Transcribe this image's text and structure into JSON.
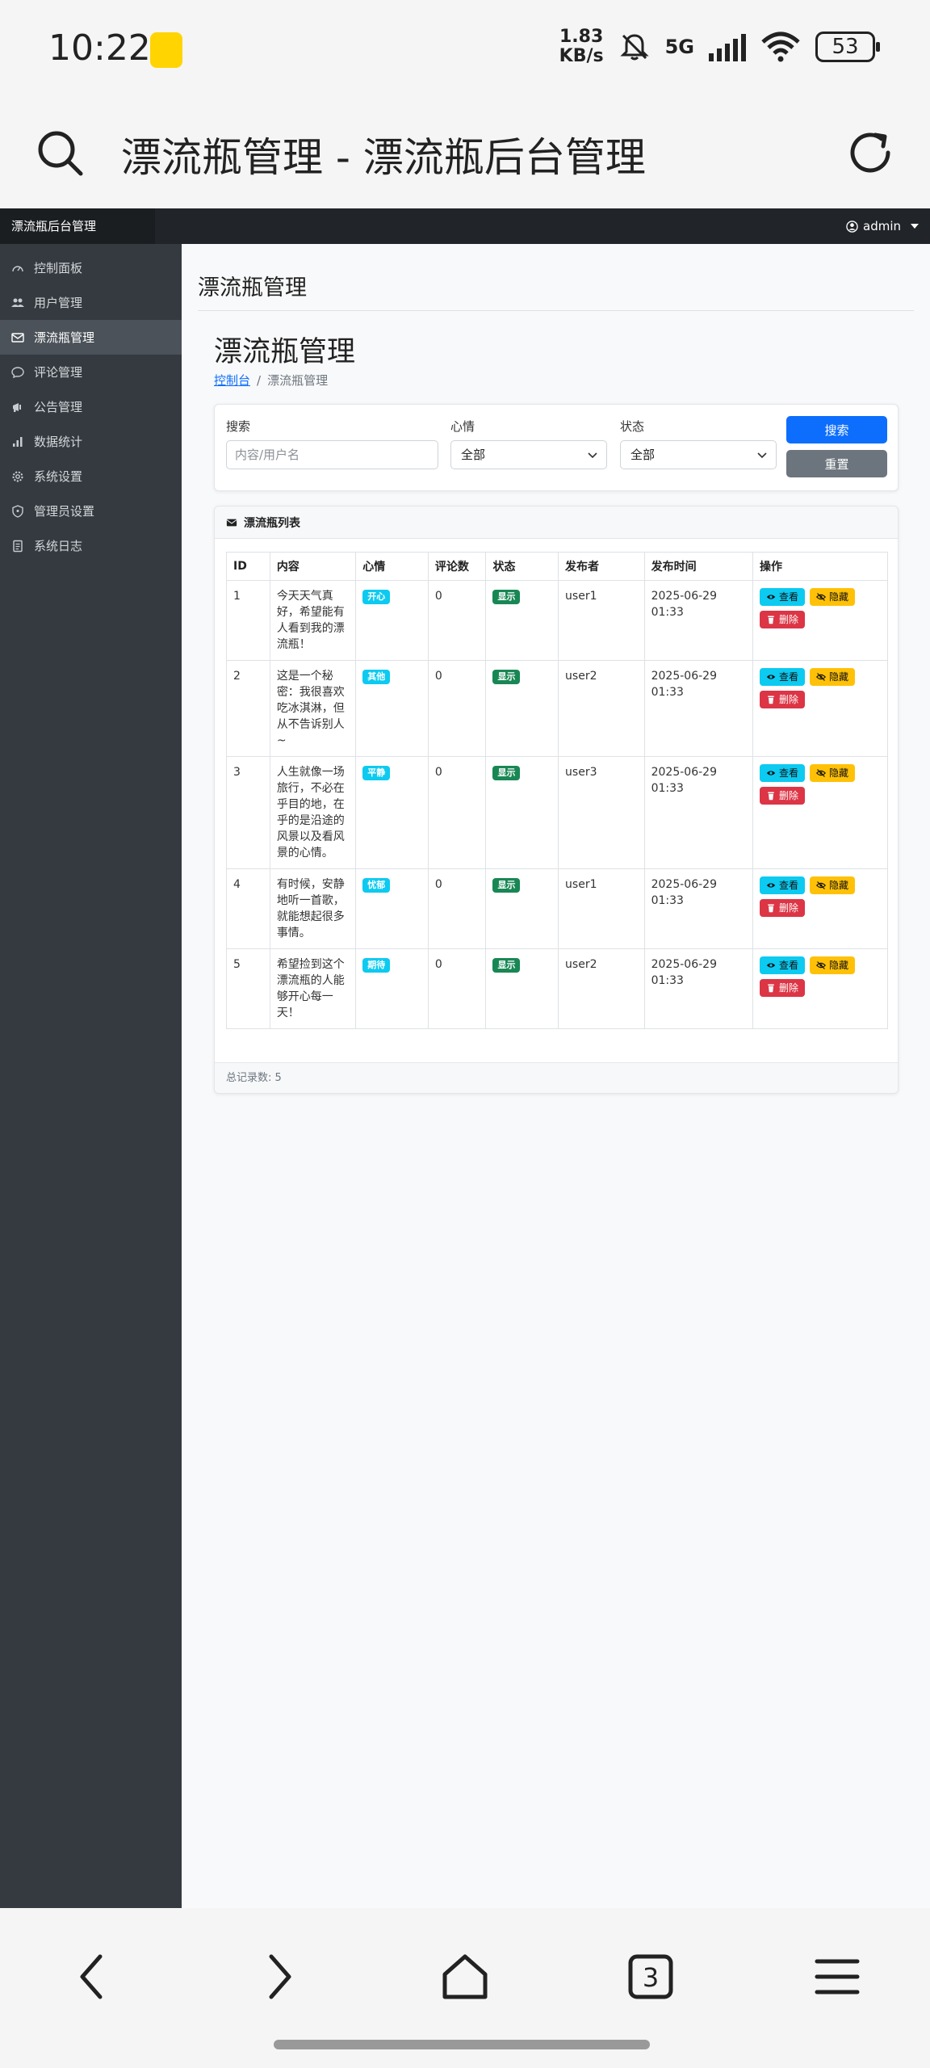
{
  "status_bar": {
    "time": "10:22",
    "net_speed_value": "1.83",
    "net_speed_unit": "KB/s",
    "network": "5G",
    "wifi_sub": "6",
    "battery": "53"
  },
  "browser": {
    "title": "漂流瓶管理 - 漂流瓶后台管理"
  },
  "navbar": {
    "brand": "漂流瓶后台管理",
    "user": "admin"
  },
  "sidebar": {
    "items": [
      {
        "label": "控制面板",
        "icon": "speedometer-icon"
      },
      {
        "label": "用户管理",
        "icon": "users-icon"
      },
      {
        "label": "漂流瓶管理",
        "icon": "envelope-icon",
        "active": true
      },
      {
        "label": "评论管理",
        "icon": "chat-icon"
      },
      {
        "label": "公告管理",
        "icon": "megaphone-icon"
      },
      {
        "label": "数据统计",
        "icon": "bar-chart-icon"
      },
      {
        "label": "系统设置",
        "icon": "gear-icon"
      },
      {
        "label": "管理员设置",
        "icon": "shield-icon"
      },
      {
        "label": "系统日志",
        "icon": "log-icon"
      }
    ]
  },
  "page": {
    "head": "漂流瓶管理",
    "title": "漂流瓶管理",
    "breadcrumb": {
      "home": "控制台",
      "current": "漂流瓶管理"
    }
  },
  "filter": {
    "search_label": "搜索",
    "search_placeholder": "内容/用户名",
    "search_value": "",
    "mood_label": "心情",
    "mood_value": "全部",
    "status_label": "状态",
    "status_value": "全部",
    "search_button": "搜索",
    "reset_button": "重置"
  },
  "list": {
    "title": "漂流瓶列表",
    "columns": [
      "ID",
      "内容",
      "心情",
      "评论数",
      "状态",
      "发布者",
      "发布时间",
      "操作"
    ],
    "actions": {
      "view": "查看",
      "hide": "隐藏",
      "delete": "删除"
    },
    "rows": [
      {
        "id": "1",
        "content": "今天天气真好，希望能有人看到我的漂流瓶！",
        "mood": "开心",
        "comments": "0",
        "status": "显示",
        "user": "user1",
        "date": "2025-06-29",
        "time": "01:33"
      },
      {
        "id": "2",
        "content": "这是一个秘密：我很喜欢吃冰淇淋，但从不告诉别人~",
        "mood": "其他",
        "comments": "0",
        "status": "显示",
        "user": "user2",
        "date": "2025-06-29",
        "time": "01:33"
      },
      {
        "id": "3",
        "content": "人生就像一场旅行，不必在乎目的地，在乎的是沿途的风景以及看风景的心情。",
        "mood": "平静",
        "comments": "0",
        "status": "显示",
        "user": "user3",
        "date": "2025-06-29",
        "time": "01:33"
      },
      {
        "id": "4",
        "content": "有时候，安静地听一首歌，就能想起很多事情。",
        "mood": "忧郁",
        "comments": "0",
        "status": "显示",
        "user": "user1",
        "date": "2025-06-29",
        "time": "01:33"
      },
      {
        "id": "5",
        "content": "希望捡到这个漂流瓶的人能够开心每一天！",
        "mood": "期待",
        "comments": "0",
        "status": "显示",
        "user": "user2",
        "date": "2025-06-29",
        "time": "01:33"
      }
    ],
    "total_label": "总记录数: 5"
  }
}
